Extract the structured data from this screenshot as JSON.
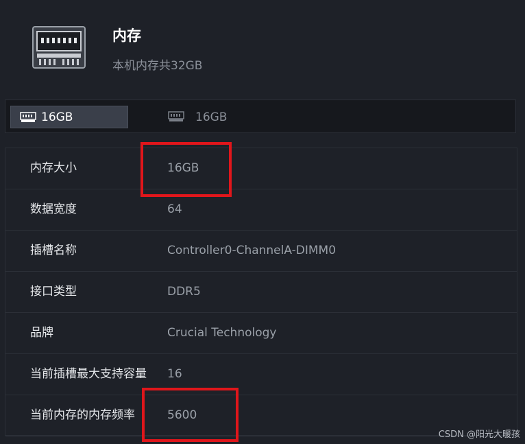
{
  "header": {
    "title": "内存",
    "subtitle": "本机内存共32GB",
    "icon": "memory-module-icon"
  },
  "tabs": [
    {
      "label": "16GB",
      "active": true,
      "icon": "memory-stick-icon"
    },
    {
      "label": "16GB",
      "active": false,
      "icon": "memory-stick-icon"
    }
  ],
  "details": [
    {
      "label": "内存大小",
      "value": "16GB"
    },
    {
      "label": "数据宽度",
      "value": "64"
    },
    {
      "label": "插槽名称",
      "value": "Controller0-ChannelA-DIMM0"
    },
    {
      "label": "接口类型",
      "value": "DDR5"
    },
    {
      "label": "品牌",
      "value": "Crucial Technology"
    },
    {
      "label": "当前插槽最大支持容量",
      "value": "16"
    },
    {
      "label": "当前内存的内存频率",
      "value": "5600"
    }
  ],
  "annotations": {
    "highlight_color": "#e0161b"
  },
  "watermark": "CSDN @阳光大暖孩"
}
